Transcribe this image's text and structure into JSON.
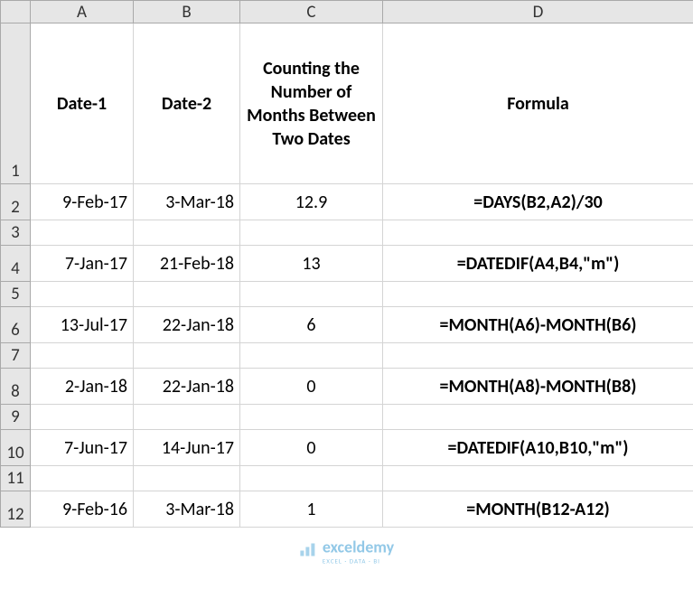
{
  "columns": {
    "A": "A",
    "B": "B",
    "C": "C",
    "D": "D"
  },
  "rownums": [
    "1",
    "2",
    "3",
    "4",
    "5",
    "6",
    "7",
    "8",
    "9",
    "10",
    "11",
    "12"
  ],
  "headers": {
    "A": "Date-1",
    "B": "Date-2",
    "C": "Counting the Number of Months Between Two Dates",
    "D": "Formula"
  },
  "rows": [
    {
      "A": "9-Feb-17",
      "B": "3-Mar-18",
      "C": "12.9",
      "D": "=DAYS(B2,A2)/30"
    },
    {
      "A": "",
      "B": "",
      "C": "",
      "D": ""
    },
    {
      "A": "7-Jan-17",
      "B": "21-Feb-18",
      "C": "13",
      "D": "=DATEDIF(A4,B4,\"m\")"
    },
    {
      "A": "",
      "B": "",
      "C": "",
      "D": ""
    },
    {
      "A": "13-Jul-17",
      "B": "22-Jan-18",
      "C": "6",
      "D": "=MONTH(A6)-MONTH(B6)"
    },
    {
      "A": "",
      "B": "",
      "C": "",
      "D": ""
    },
    {
      "A": "2-Jan-18",
      "B": "22-Jan-18",
      "C": "0",
      "D": "=MONTH(A8)-MONTH(B8)"
    },
    {
      "A": "",
      "B": "",
      "C": "",
      "D": ""
    },
    {
      "A": "7-Jun-17",
      "B": "14-Jun-17",
      "C": "0",
      "D": "=DATEDIF(A10,B10,\"m\")"
    },
    {
      "A": "",
      "B": "",
      "C": "",
      "D": ""
    },
    {
      "A": "9-Feb-16",
      "B": "3-Mar-18",
      "C": "1",
      "D": "=MONTH(B12-A12)"
    }
  ],
  "watermark": {
    "name": "exceldemy",
    "sub": "EXCEL · DATA · BI"
  },
  "chart_data": {
    "type": "table",
    "title": "Counting the Number of Months Between Two Dates",
    "columns": [
      "Date-1",
      "Date-2",
      "Counting the Number of Months Between Two Dates",
      "Formula"
    ],
    "rows": [
      [
        "9-Feb-17",
        "3-Mar-18",
        12.9,
        "=DAYS(B2,A2)/30"
      ],
      [
        "7-Jan-17",
        "21-Feb-18",
        13,
        "=DATEDIF(A4,B4,\"m\")"
      ],
      [
        "13-Jul-17",
        "22-Jan-18",
        6,
        "=MONTH(A6)-MONTH(B6)"
      ],
      [
        "2-Jan-18",
        "22-Jan-18",
        0,
        "=MONTH(A8)-MONTH(B8)"
      ],
      [
        "7-Jun-17",
        "14-Jun-17",
        0,
        "=DATEDIF(A10,B10,\"m\")"
      ],
      [
        "9-Feb-16",
        "3-Mar-18",
        1,
        "=MONTH(B12-A12)"
      ]
    ]
  }
}
